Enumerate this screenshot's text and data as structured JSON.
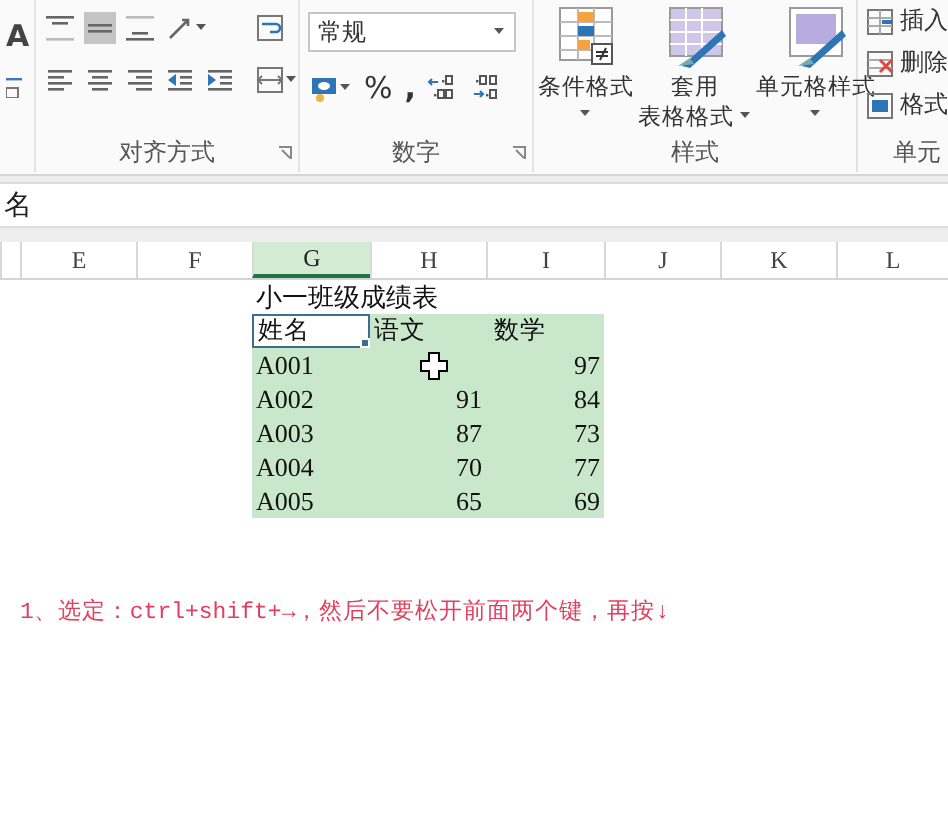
{
  "ribbon": {
    "font_group_partial": {
      "grow_font": "A"
    },
    "alignment": {
      "label": "对齐方式",
      "middle_align_selected": true
    },
    "number": {
      "format": "常规",
      "percent": "%",
      "comma": ",",
      "label": "数字"
    },
    "styles": {
      "buttons": [
        {
          "lines": [
            "条件格式"
          ]
        },
        {
          "lines": [
            "套用",
            "表格格式"
          ]
        },
        {
          "lines": [
            "单元格样式"
          ]
        }
      ],
      "label": "样式"
    },
    "cells": {
      "items": [
        "插入",
        "删除",
        "格式"
      ],
      "label": "单元"
    }
  },
  "formula_bar": {
    "content": "名"
  },
  "sheet": {
    "columns": [
      {
        "label": "E",
        "selected": false
      },
      {
        "label": "F",
        "selected": false
      },
      {
        "label": "G",
        "selected": true
      },
      {
        "label": "H",
        "selected": false
      },
      {
        "label": "I",
        "selected": false
      },
      {
        "label": "J",
        "selected": false
      },
      {
        "label": "K",
        "selected": false
      },
      {
        "label": "L",
        "selected": false
      }
    ],
    "title": "小一班级成绩表",
    "header": {
      "selected": true,
      "cells": [
        {
          "text": "姓名",
          "active": true
        },
        {
          "text": "语文",
          "active": false
        },
        {
          "text": "数学",
          "active": false
        }
      ]
    },
    "rows": [
      {
        "selected": true,
        "name": "A001",
        "math": "97"
      },
      {
        "selected": true,
        "name": "A002",
        "chinese": "91",
        "math": "84"
      },
      {
        "selected": true,
        "name": "A003",
        "chinese": "87",
        "math": "73"
      },
      {
        "selected": true,
        "name": "A004",
        "chinese": "70",
        "math": "77"
      },
      {
        "selected": true,
        "name": "A005",
        "chinese": "65",
        "math": "69"
      }
    ]
  },
  "note": "1、选定：ctrl+shift+→，然后不要松开前面两个键，再按↓"
}
